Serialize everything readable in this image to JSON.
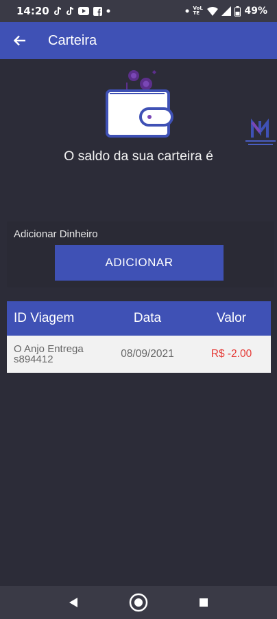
{
  "status_bar": {
    "time": "14:20",
    "network": "VoLTE",
    "battery": "49%"
  },
  "app_bar": {
    "title": "Carteira"
  },
  "balance": {
    "message": "O saldo da sua carteira é"
  },
  "add_money": {
    "label": "Adicionar Dinheiro",
    "button_label": "ADICIONAR"
  },
  "trip_table": {
    "headers": {
      "id": "ID Viagem",
      "date": "Data",
      "value": "Valor"
    },
    "rows": [
      {
        "id_line1": "O Anjo Entrega",
        "id_line2": "s894412",
        "date": "08/09/2021",
        "value": "R$ -2.00"
      }
    ]
  },
  "colors": {
    "primary": "#3f51b5",
    "background": "#2c2c38",
    "negative": "#e53935"
  }
}
